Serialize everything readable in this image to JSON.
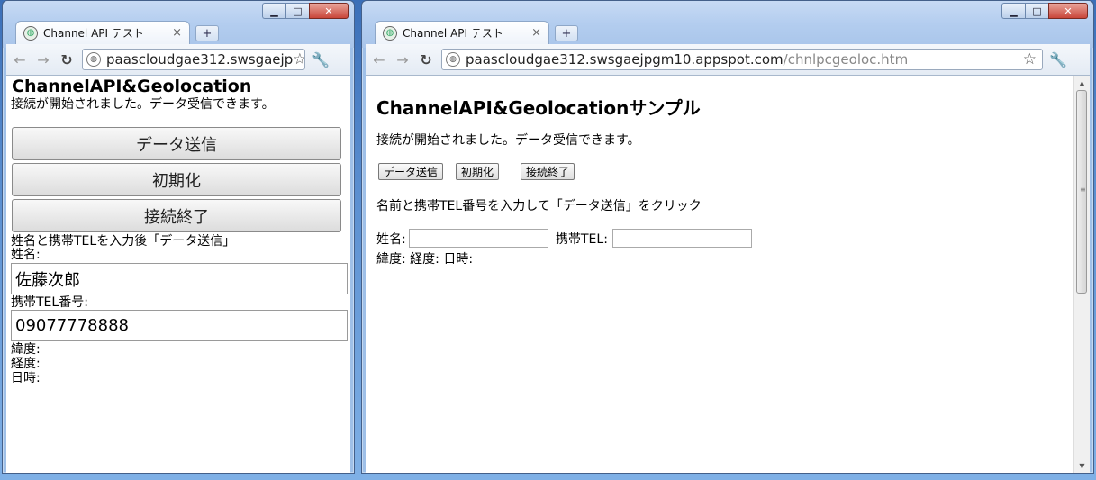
{
  "left_window": {
    "tab_title": "Channel API テスト",
    "tab_close": "×",
    "new_tab": "+",
    "url_host": "paascloudgae312.swsgaejp",
    "url_path": "",
    "page": {
      "title": "ChannelAPI&Geolocation",
      "status": "接続が開始されました。データ受信できます。",
      "buttons": {
        "send": "データ送信",
        "init": "初期化",
        "end": "接続終了"
      },
      "instruction": "姓名と携帯TELを入力後「データ送信」",
      "name_label": "姓名:",
      "name_value": "佐藤次郎",
      "tel_label": "携帯TEL番号:",
      "tel_value": "09077778888",
      "lat_label": "緯度:",
      "lng_label": "経度:",
      "time_label": "日時:"
    }
  },
  "right_window": {
    "tab_title": "Channel API テスト",
    "tab_close": "×",
    "new_tab": "+",
    "url_host": "paascloudgae312.swsgaejpgm10.appspot.com",
    "url_path": "/chnlpcgeoloc.htm",
    "page": {
      "title": "ChannelAPI&Geolocationサンプル",
      "status": "接続が開始されました。データ受信できます。",
      "buttons": {
        "send": "データ送信",
        "init": "初期化",
        "end": "接続終了"
      },
      "instruction": "名前と携帯TEL番号を入力して「データ送信」をクリック",
      "name_label": "姓名:",
      "tel_label": "携帯TEL:",
      "geo_line": "緯度: 経度: 日時:"
    }
  },
  "window_controls": {
    "minimize": "▁",
    "maximize": "□",
    "close": "✕"
  },
  "icons": {
    "back": "←",
    "forward": "→",
    "reload": "↻",
    "star": "☆",
    "wrench": "🔧",
    "globe": "◍"
  }
}
